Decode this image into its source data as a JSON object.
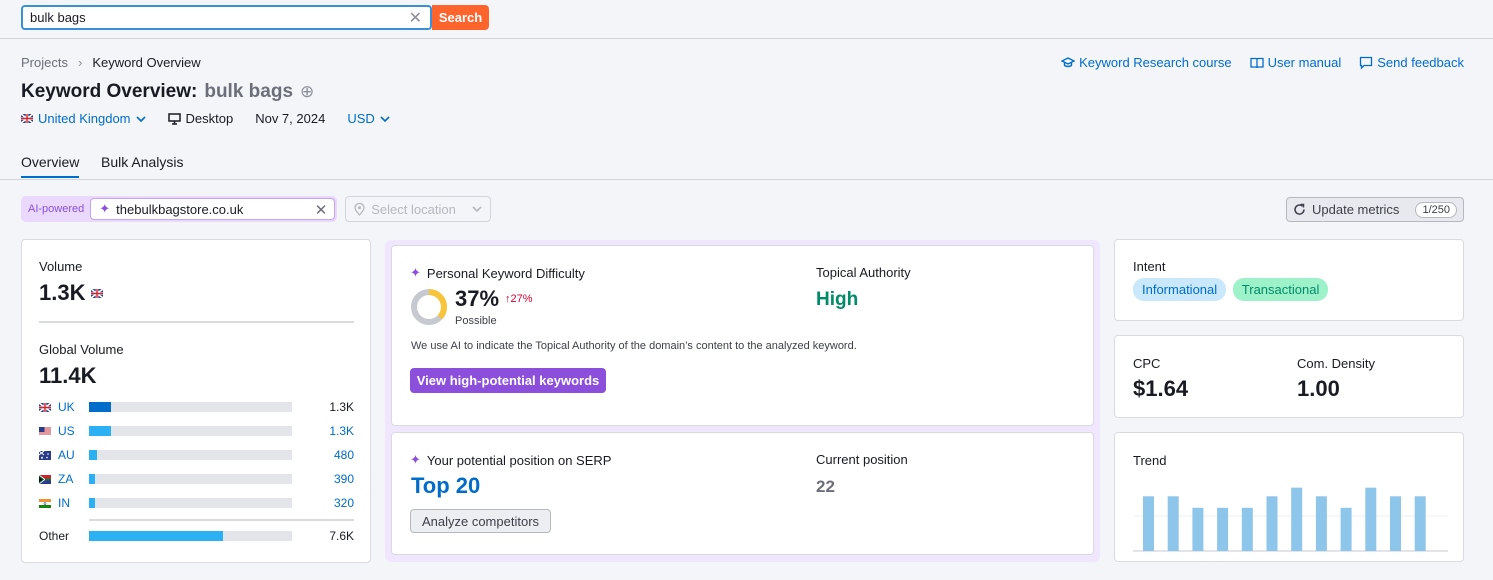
{
  "search": {
    "value": "bulk bags",
    "button_label": "Search"
  },
  "breadcrumb": {
    "root": "Projects",
    "current": "Keyword Overview"
  },
  "links": {
    "course": "Keyword Research course",
    "manual": "User manual",
    "feedback": "Send feedback"
  },
  "title": {
    "prefix": "Keyword Overview:",
    "keyword": "bulk bags"
  },
  "meta": {
    "country": "United Kingdom",
    "device": "Desktop",
    "date": "Nov 7, 2024",
    "currency": "USD"
  },
  "tabs": [
    {
      "label": "Overview"
    },
    {
      "label": "Bulk Analysis"
    }
  ],
  "ai": {
    "label": "AI-powered",
    "domain": "thebulkbagstore.co.uk",
    "location_placeholder": "Select location"
  },
  "update": {
    "label": "Update metrics",
    "count": "1/250"
  },
  "volume": {
    "label": "Volume",
    "value": "1.3K"
  },
  "global_volume": {
    "label": "Global Volume",
    "value": "11.4K",
    "countries": [
      {
        "code": "UK",
        "value": "1.3K",
        "share": 0.11,
        "color": "#006dca"
      },
      {
        "code": "US",
        "value": "1.3K",
        "share": 0.11,
        "color": "#2bb1f3"
      },
      {
        "code": "AU",
        "value": "480",
        "share": 0.04,
        "color": "#2bb1f3"
      },
      {
        "code": "ZA",
        "value": "390",
        "share": 0.03,
        "color": "#2bb1f3"
      },
      {
        "code": "IN",
        "value": "320",
        "share": 0.03,
        "color": "#2bb1f3"
      }
    ],
    "other": {
      "label": "Other",
      "value": "7.6K",
      "share": 0.66
    }
  },
  "pkd": {
    "label": "Personal Keyword Difficulty",
    "value": "37%",
    "change": "27%",
    "level": "Possible",
    "percent": 37,
    "topical_label": "Topical Authority",
    "topical_value": "High",
    "note": "We use AI to indicate the Topical Authority of the domain’s content to the analyzed keyword.",
    "button": "View high-potential keywords"
  },
  "serp": {
    "label": "Your potential position on SERP",
    "value": "Top 20",
    "current_label": "Current position",
    "current_value": "22",
    "button": "Analyze competitors"
  },
  "intent": {
    "label": "Intent",
    "tags": [
      "Informational",
      "Transactional"
    ]
  },
  "cpc": {
    "label": "CPC",
    "value": "$1.64"
  },
  "density": {
    "label": "Com. Density",
    "value": "1.00"
  },
  "trend": {
    "label": "Trend",
    "values": [
      0.76,
      0.76,
      0.6,
      0.6,
      0.6,
      0.76,
      0.88,
      0.76,
      0.6,
      0.88,
      0.76,
      0.76
    ]
  },
  "colors": {
    "accent": "#006dca",
    "search_button": "#ff642d",
    "ai_purple": "#8b4fdc",
    "success": "#008b69",
    "trend_bar": "#8ec5ea"
  }
}
